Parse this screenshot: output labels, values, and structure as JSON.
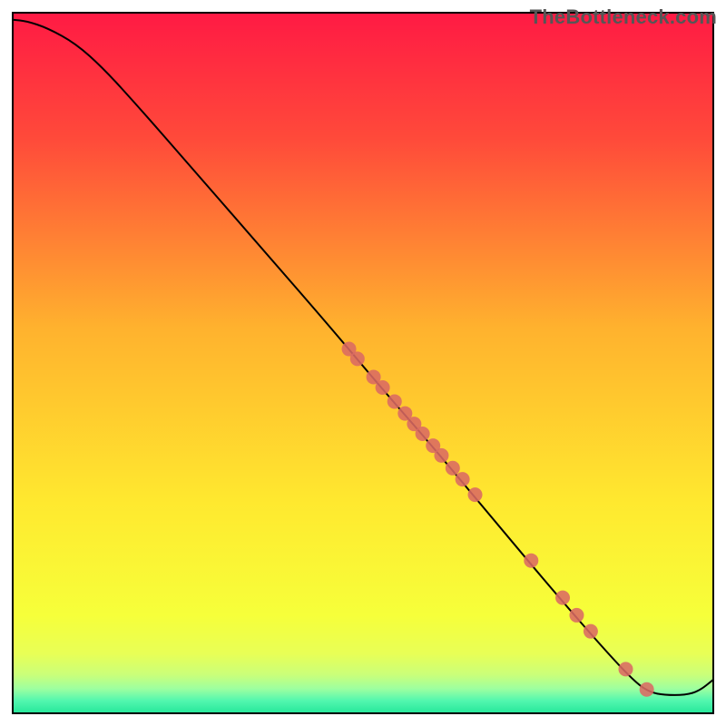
{
  "watermark": "TheBottleneck.com",
  "chart_data": {
    "type": "line",
    "title": "",
    "xlabel": "",
    "ylabel": "",
    "xlim": [
      0,
      100
    ],
    "ylim": [
      0,
      100
    ],
    "grid": false,
    "background_gradient": {
      "type": "vertical",
      "stops": [
        {
          "pos": 0.0,
          "color": "#ff1a44"
        },
        {
          "pos": 0.18,
          "color": "#ff4a3a"
        },
        {
          "pos": 0.45,
          "color": "#ffb22e"
        },
        {
          "pos": 0.7,
          "color": "#ffe92f"
        },
        {
          "pos": 0.86,
          "color": "#f6ff3a"
        },
        {
          "pos": 0.915,
          "color": "#e8ff56"
        },
        {
          "pos": 0.945,
          "color": "#caff7a"
        },
        {
          "pos": 0.965,
          "color": "#9dffa0"
        },
        {
          "pos": 0.982,
          "color": "#52f7af"
        },
        {
          "pos": 1.0,
          "color": "#25e79a"
        }
      ]
    },
    "series": [
      {
        "name": "bottleneck-curve",
        "color": "#000000",
        "stroke_width": 2,
        "points": [
          {
            "x": 0.0,
            "y": 99.0
          },
          {
            "x": 2.0,
            "y": 98.8
          },
          {
            "x": 5.0,
            "y": 97.8
          },
          {
            "x": 9.0,
            "y": 95.6
          },
          {
            "x": 13.0,
            "y": 92.0
          },
          {
            "x": 18.0,
            "y": 86.5
          },
          {
            "x": 25.0,
            "y": 78.5
          },
          {
            "x": 35.0,
            "y": 67.0
          },
          {
            "x": 45.0,
            "y": 55.5
          },
          {
            "x": 53.0,
            "y": 46.0
          },
          {
            "x": 60.0,
            "y": 38.0
          },
          {
            "x": 70.0,
            "y": 26.0
          },
          {
            "x": 78.0,
            "y": 16.5
          },
          {
            "x": 85.0,
            "y": 8.5
          },
          {
            "x": 89.0,
            "y": 4.3
          },
          {
            "x": 91.0,
            "y": 3.0
          },
          {
            "x": 93.0,
            "y": 2.6
          },
          {
            "x": 96.0,
            "y": 2.6
          },
          {
            "x": 98.0,
            "y": 3.2
          },
          {
            "x": 100.0,
            "y": 4.8
          }
        ]
      }
    ],
    "markers": {
      "color": "#db6a63",
      "radius": 8,
      "points": [
        {
          "x": 48.0,
          "y": 52.0
        },
        {
          "x": 49.2,
          "y": 50.6
        },
        {
          "x": 51.5,
          "y": 48.0
        },
        {
          "x": 52.8,
          "y": 46.5
        },
        {
          "x": 54.5,
          "y": 44.5
        },
        {
          "x": 56.0,
          "y": 42.8
        },
        {
          "x": 57.3,
          "y": 41.3
        },
        {
          "x": 58.5,
          "y": 39.9
        },
        {
          "x": 60.0,
          "y": 38.2
        },
        {
          "x": 61.2,
          "y": 36.8
        },
        {
          "x": 62.8,
          "y": 35.0
        },
        {
          "x": 64.2,
          "y": 33.4
        },
        {
          "x": 66.0,
          "y": 31.2
        },
        {
          "x": 74.0,
          "y": 21.8
        },
        {
          "x": 78.5,
          "y": 16.5
        },
        {
          "x": 80.5,
          "y": 14.0
        },
        {
          "x": 82.5,
          "y": 11.7
        },
        {
          "x": 87.5,
          "y": 6.3
        },
        {
          "x": 90.5,
          "y": 3.4
        }
      ]
    }
  }
}
